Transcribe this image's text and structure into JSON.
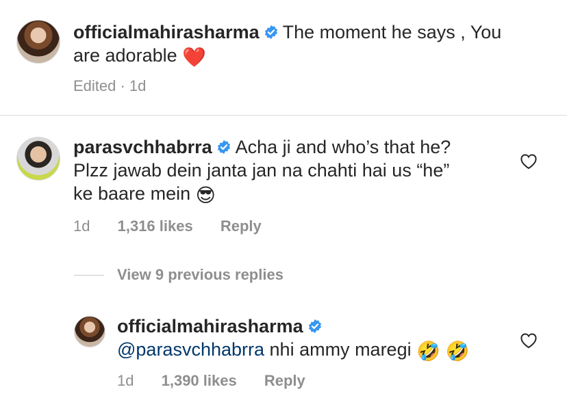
{
  "caption": {
    "username": "officialmahirasharma",
    "text_line1": "The moment he says , You",
    "text_line2": "are adorable",
    "emoji": "❤️",
    "meta_text": "Edited · 1d"
  },
  "comment": {
    "username": "parasvchhabrra",
    "text_line1": "Acha ji and who’s that he?",
    "text_line2": "Plzz jawab dein janta jan na chahti hai us “he”",
    "text_line3": "ke baare mein",
    "emoji": "😎",
    "time": "1d",
    "likes": "1,316 likes",
    "reply_label": "Reply"
  },
  "view_replies": "View 9 previous replies",
  "reply": {
    "username": "officialmahirasharma",
    "mention": "@parasvchhabrra",
    "text": "nhi ammy maregi",
    "emoji": "🤣 🤣",
    "time": "1d",
    "likes": "1,390 likes",
    "reply_label": "Reply"
  },
  "colors": {
    "verified": "#3897f0",
    "heart_red": "#d01f2f",
    "meta_grey": "#8e8e8e",
    "mention": "#00376b"
  }
}
